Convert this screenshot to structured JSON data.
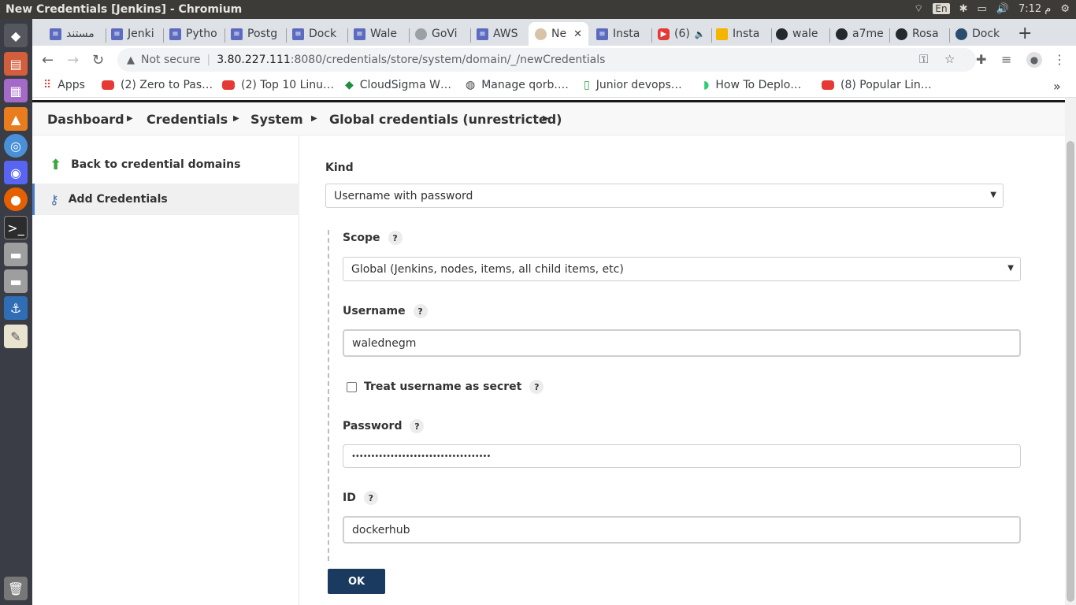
{
  "window": {
    "title": "New Credentials [Jenkins] - Chromium"
  },
  "system_tray": {
    "lang": "En",
    "time": "7:12 م"
  },
  "tabs": [
    {
      "label": "مستند",
      "icon": "doc-icon"
    },
    {
      "label": "Jenki",
      "icon": "doc-icon"
    },
    {
      "label": "Pytho",
      "icon": "doc-icon"
    },
    {
      "label": "Postg",
      "icon": "doc-icon"
    },
    {
      "label": "Dock",
      "icon": "doc-icon"
    },
    {
      "label": "Wale",
      "icon": "doc-icon"
    },
    {
      "label": "GoVi",
      "icon": "globe-icon"
    },
    {
      "label": "AWS",
      "icon": "doc-icon"
    },
    {
      "label": "Ne",
      "icon": "jenkins-icon",
      "active": true
    },
    {
      "label": "Insta",
      "icon": "doc-icon"
    },
    {
      "label": "(6)",
      "icon": "youtube-icon"
    },
    {
      "label": "Insta",
      "icon": "box-icon"
    },
    {
      "label": "wale",
      "icon": "github-icon"
    },
    {
      "label": "a7me",
      "icon": "github-icon"
    },
    {
      "label": "Rosa",
      "icon": "github-icon"
    },
    {
      "label": "Dock",
      "icon": "docker-icon"
    }
  ],
  "address": {
    "security": "Not secure",
    "host": "3.80.227.111",
    "path": ":8080/credentials/store/system/domain/_/newCredentials"
  },
  "bookmarks": [
    {
      "label": "Apps",
      "icon": "apps-grid-icon"
    },
    {
      "label": "(2) Zero to Pas…",
      "icon": "youtube-icon"
    },
    {
      "label": "(2) Top 10 Linu…",
      "icon": "youtube-icon"
    },
    {
      "label": "CloudSigma W…",
      "icon": "cloudsigma-icon"
    },
    {
      "label": "Manage qorb.…",
      "icon": "globe-icon"
    },
    {
      "label": "Junior devops…",
      "icon": "bookmark-green-icon"
    },
    {
      "label": "How To Deplo…",
      "icon": "digitalocean-icon"
    },
    {
      "label": "(8) Popular Lin…",
      "icon": "youtube-icon"
    }
  ],
  "breadcrumbs": [
    "Dashboard",
    "Credentials",
    "System",
    "Global credentials (unrestricted)"
  ],
  "side": {
    "back": "Back to credential domains",
    "add": "Add Credentials"
  },
  "form": {
    "kind_label": "Kind",
    "kind_value": "Username with password",
    "scope_label": "Scope",
    "scope_value": "Global (Jenkins, nodes, items, all child items, etc)",
    "username_label": "Username",
    "username_value": "walednegm",
    "secret_label": "Treat username as secret",
    "password_label": "Password",
    "password_value": "••••••••••••••••••••••••••••••••••••",
    "id_label": "ID",
    "id_value": "dockerhub",
    "help": "?",
    "ok": "OK"
  }
}
